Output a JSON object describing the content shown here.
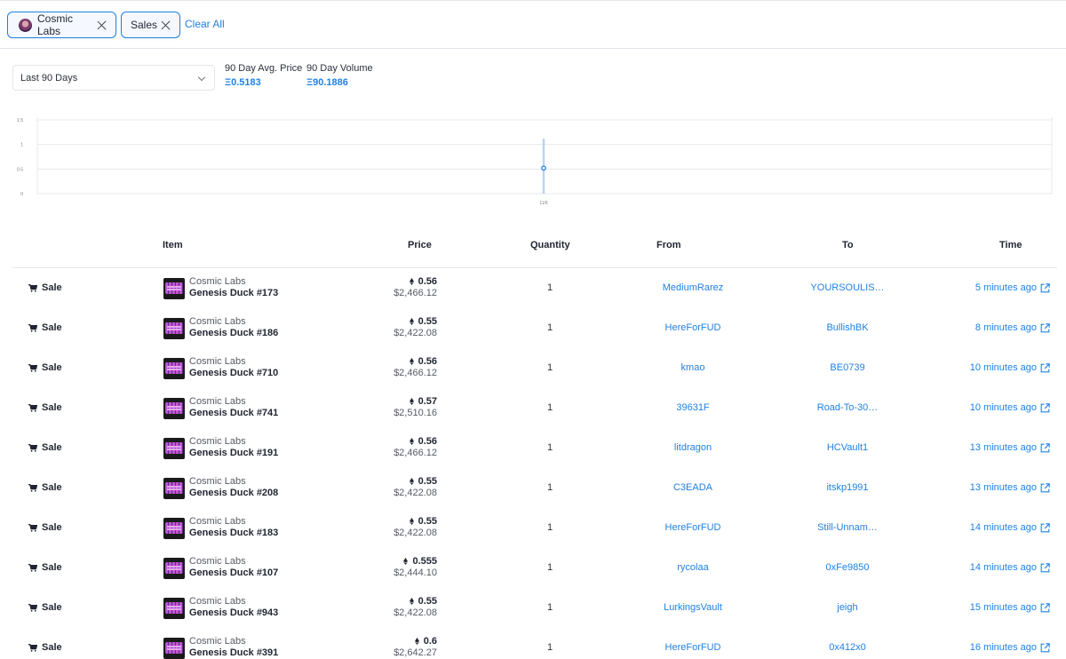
{
  "filters": {
    "chips": [
      {
        "label": "Cosmic Labs"
      },
      {
        "label": "Sales"
      }
    ],
    "clear_all": "Clear All"
  },
  "stats": {
    "period": "Last 90 Days",
    "avg_label": "90 Day Avg. Price",
    "avg_value": "Ξ0.5183",
    "vol_label": "90 Day Volume",
    "vol_value": "Ξ90.1886"
  },
  "chart_data": {
    "type": "scatter",
    "y_ticks": [
      "1.5",
      "1",
      "0.5",
      "0"
    ],
    "x_ticks": [
      "11/6"
    ],
    "ylim": [
      0,
      1.5
    ],
    "points": [
      {
        "x": "11/6",
        "y": 0.52,
        "low": 0,
        "high": 1.12
      }
    ],
    "grid": true
  },
  "table": {
    "headers": {
      "item": "Item",
      "price": "Price",
      "quantity": "Quantity",
      "from": "From",
      "to": "To",
      "time": "Time"
    },
    "rows": [
      {
        "event": "Sale",
        "collection": "Cosmic Labs",
        "item": "Genesis Duck #173",
        "eth": "0.56",
        "usd": "$2,466.12",
        "qty": "1",
        "from": "MediumRarez",
        "to": "YOURSOULIS…",
        "time": "5 minutes ago"
      },
      {
        "event": "Sale",
        "collection": "Cosmic Labs",
        "item": "Genesis Duck #186",
        "eth": "0.55",
        "usd": "$2,422.08",
        "qty": "1",
        "from": "HereForFUD",
        "to": "BullishBK",
        "time": "8 minutes ago"
      },
      {
        "event": "Sale",
        "collection": "Cosmic Labs",
        "item": "Genesis Duck #710",
        "eth": "0.56",
        "usd": "$2,466.12",
        "qty": "1",
        "from": "kmao",
        "to": "BE0739",
        "time": "10 minutes ago"
      },
      {
        "event": "Sale",
        "collection": "Cosmic Labs",
        "item": "Genesis Duck #741",
        "eth": "0.57",
        "usd": "$2,510.16",
        "qty": "1",
        "from": "39631F",
        "to": "Road-To-30…",
        "time": "10 minutes ago"
      },
      {
        "event": "Sale",
        "collection": "Cosmic Labs",
        "item": "Genesis Duck #191",
        "eth": "0.56",
        "usd": "$2,466.12",
        "qty": "1",
        "from": "litdragon",
        "to": "HCVault1",
        "time": "13 minutes ago"
      },
      {
        "event": "Sale",
        "collection": "Cosmic Labs",
        "item": "Genesis Duck #208",
        "eth": "0.55",
        "usd": "$2,422.08",
        "qty": "1",
        "from": "C3EADA",
        "to": "itskp1991",
        "time": "13 minutes ago"
      },
      {
        "event": "Sale",
        "collection": "Cosmic Labs",
        "item": "Genesis Duck #183",
        "eth": "0.55",
        "usd": "$2,422.08",
        "qty": "1",
        "from": "HereForFUD",
        "to": "Still-Unnam…",
        "time": "14 minutes ago"
      },
      {
        "event": "Sale",
        "collection": "Cosmic Labs",
        "item": "Genesis Duck #107",
        "eth": "0.555",
        "usd": "$2,444.10",
        "qty": "1",
        "from": "rycolaa",
        "to": "0xFe9850",
        "time": "14 minutes ago"
      },
      {
        "event": "Sale",
        "collection": "Cosmic Labs",
        "item": "Genesis Duck #943",
        "eth": "0.55",
        "usd": "$2,422.08",
        "qty": "1",
        "from": "LurkingsVault",
        "to": "jeigh",
        "time": "15 minutes ago"
      },
      {
        "event": "Sale",
        "collection": "Cosmic Labs",
        "item": "Genesis Duck #391",
        "eth": "0.6",
        "usd": "$2,642.27",
        "qty": "1",
        "from": "HereForFUD",
        "to": "0x412x0",
        "time": "16 minutes ago"
      }
    ]
  },
  "colors": {
    "accent": "#2081e2",
    "text": "#1f2430",
    "muted": "#555b66",
    "border": "#e3e6ea"
  }
}
